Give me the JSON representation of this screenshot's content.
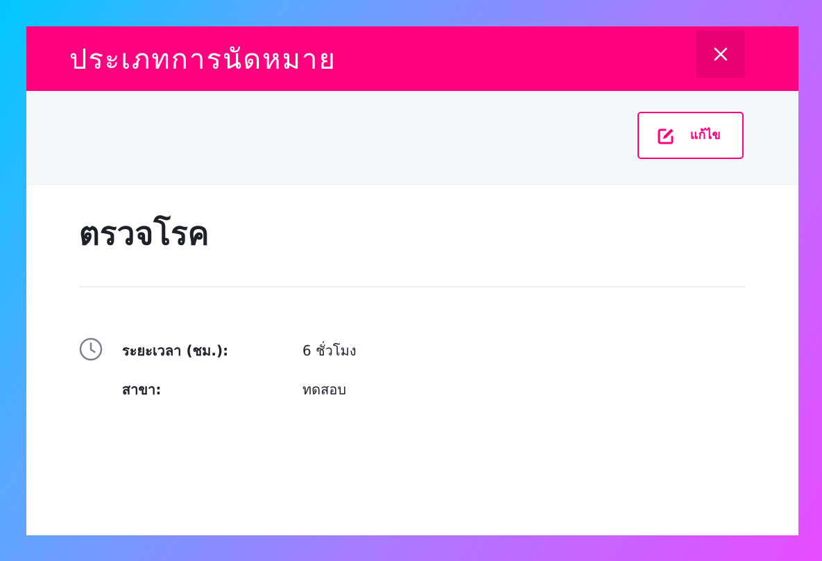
{
  "header": {
    "title": "ประเภทการนัดหมาย",
    "close_icon": "close-icon",
    "background_color": "#ff007f"
  },
  "toolbar": {
    "edit_label": "แก้ไข",
    "edit_icon": "edit-icon"
  },
  "record": {
    "title": "ตรวจโรค",
    "fields": [
      {
        "icon": "clock-icon",
        "label": "ระยะเวลา (ชม.):",
        "value": "6 ชั่วโมง"
      },
      {
        "label": "สาขา:",
        "value": "ทดสอบ"
      }
    ]
  },
  "colors": {
    "accent": "#ff007f",
    "text": "#1f2128",
    "toolbar_bg": "#f6f7fa"
  }
}
